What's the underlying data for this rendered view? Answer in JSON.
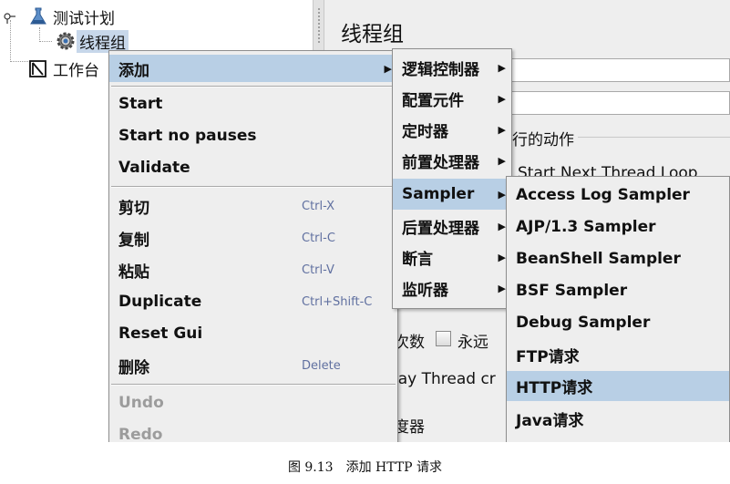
{
  "tree": {
    "test_plan": "测试计划",
    "thread_group": "线程组",
    "workbench": "工作台"
  },
  "panel": {
    "title": "线程组",
    "action_section_partial": "行的动作",
    "start_next_partial": "Start Next Thread Loop",
    "loop_count_partial": "次数",
    "forever_label": "永远",
    "delay_thread_partial": "lay Thread cr",
    "scheduler_partial": "度器"
  },
  "context_menu": {
    "add": "添加",
    "start": "Start",
    "start_no_pauses": "Start no pauses",
    "validate": "Validate",
    "cut": "剪切",
    "cut_acc": "Ctrl-X",
    "copy": "复制",
    "copy_acc": "Ctrl-C",
    "paste": "粘贴",
    "paste_acc": "Ctrl-V",
    "duplicate": "Duplicate",
    "duplicate_acc": "Ctrl+Shift-C",
    "reset_gui": "Reset Gui",
    "delete": "删除",
    "delete_acc": "Delete",
    "undo": "Undo",
    "redo": "Redo"
  },
  "add_menu": {
    "logic_controller": "逻辑控制器",
    "config_element": "配置元件",
    "timer": "定时器",
    "pre_processor": "前置处理器",
    "sampler": "Sampler",
    "post_processor": "后置处理器",
    "assertion": "断言",
    "listener": "监听器"
  },
  "sampler_menu": {
    "items": [
      "Access Log Sampler",
      "AJP/1.3 Sampler",
      "BeanShell Sampler",
      "BSF Sampler",
      "Debug Sampler",
      "FTP请求",
      "HTTP请求",
      "Java请求"
    ]
  },
  "caption": "图 9.13　添加 HTTP 请求",
  "colors": {
    "highlight": "#b8cfe5",
    "menu_bg": "#eeeeee",
    "tree_selection": "#c7d7ea"
  }
}
